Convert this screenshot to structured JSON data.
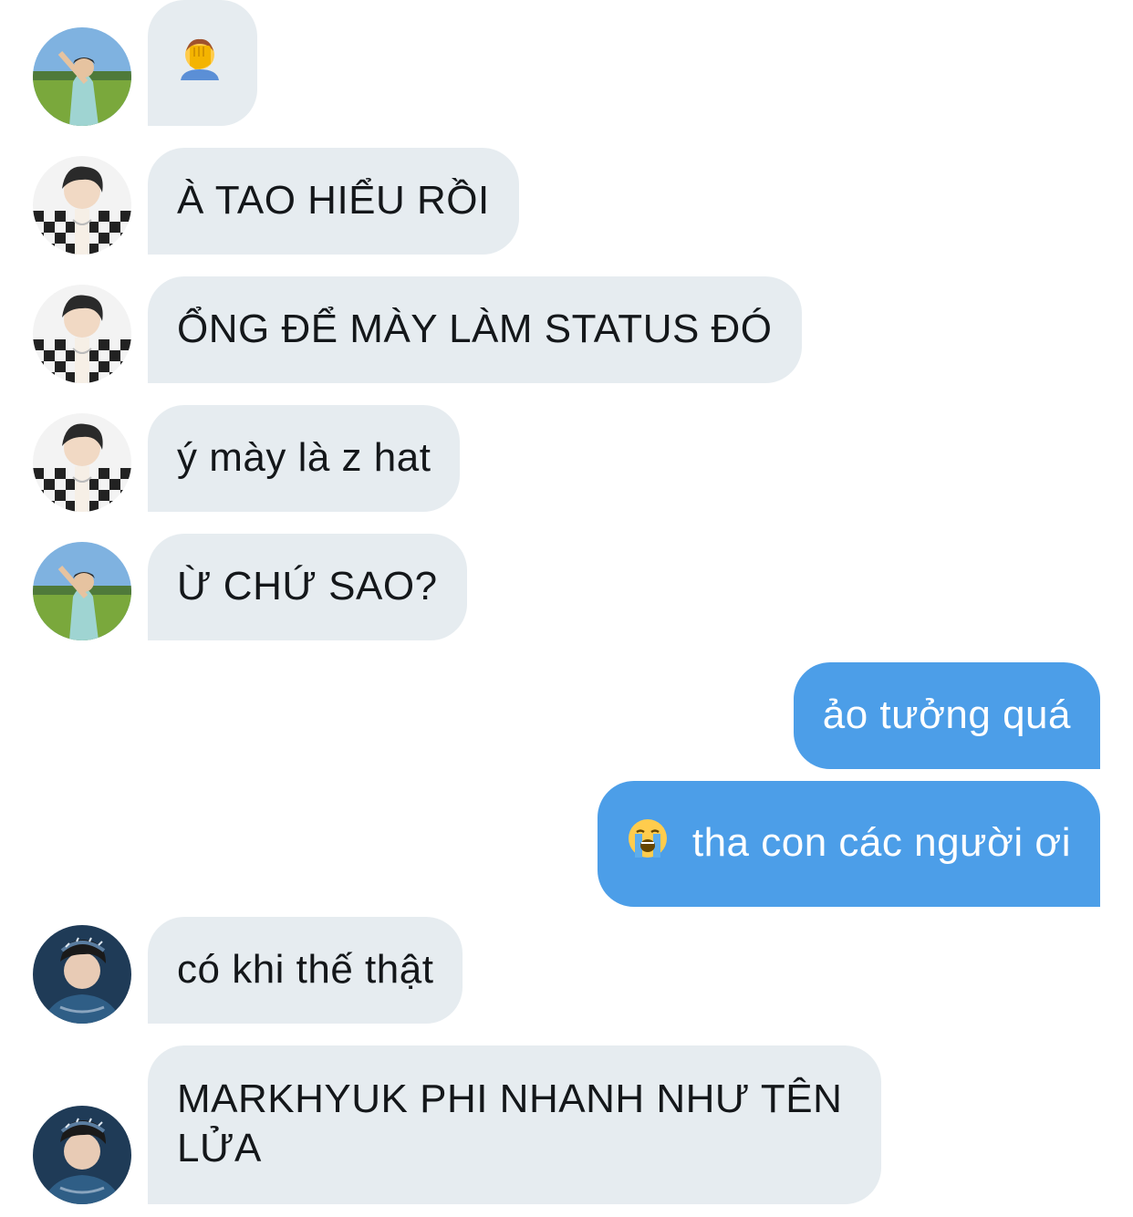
{
  "messages": [
    {
      "direction": "incoming",
      "avatar": "avatar-field-boy",
      "emoji": "face-palm-emoji",
      "text": ""
    },
    {
      "direction": "incoming",
      "avatar": "avatar-checkered-boy",
      "text": "À TAO HIỂU RỒI"
    },
    {
      "direction": "incoming",
      "avatar": "avatar-checkered-boy",
      "text": "ỔNG ĐỂ MÀY LÀM STATUS ĐÓ"
    },
    {
      "direction": "incoming",
      "avatar": "avatar-checkered-boy",
      "text": "ý mày là z hat"
    },
    {
      "direction": "incoming",
      "avatar": "avatar-field-boy",
      "text": "Ừ CHỨ SAO?"
    },
    {
      "direction": "outgoing",
      "text": "ảo tưởng quá"
    },
    {
      "direction": "outgoing",
      "emoji": "loudly-crying-emoji",
      "text": "tha con các người ơi"
    },
    {
      "direction": "incoming",
      "avatar": "avatar-bandana-boy",
      "text": "có khi thế thật"
    },
    {
      "direction": "incoming",
      "avatar": "avatar-bandana-boy",
      "text": "MARKHYUK PHI NHANH NHƯ TÊN LỬA"
    }
  ],
  "colors": {
    "incoming_bubble": "#e6ecf0",
    "outgoing_bubble": "#4c9ee8",
    "incoming_text": "#14171a",
    "outgoing_text": "#ffffff"
  }
}
